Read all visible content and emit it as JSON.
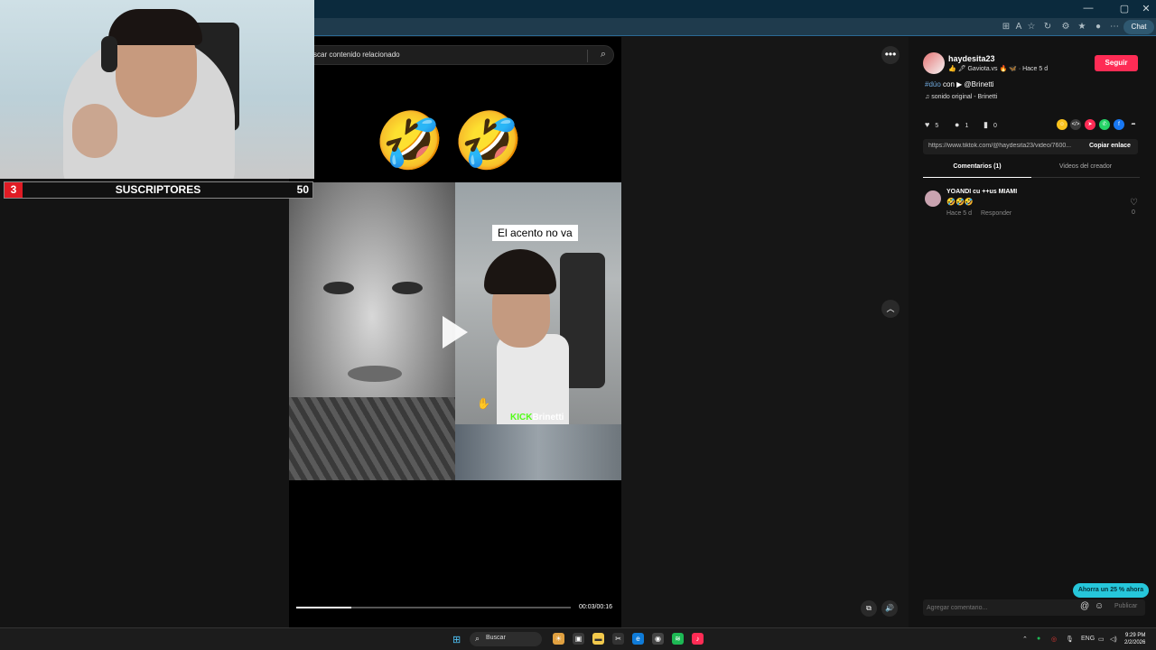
{
  "browser": {
    "chat_label": "Chat",
    "window_buttons": [
      "—",
      "▢",
      "✕"
    ]
  },
  "stream_overlay": {
    "sub_count_left": "3",
    "sub_label": "SUSCRIPTORES",
    "sub_count_right": "50"
  },
  "search": {
    "placeholder": "scar contenido relacionado"
  },
  "video": {
    "emojis": "🤣🤣",
    "caption": "El acento no va",
    "kick_brand": "KICK",
    "kick_user": "Brinetti",
    "time": "00:03/00:16",
    "progress": 0.2
  },
  "post": {
    "username": "haydesita23",
    "display_name": "👍 🖋 Gaviota.vs 🔥 🦋 · Hace 5 d",
    "follow_label": "Seguir",
    "duo_tag": "#dúo",
    "duo_text": "con",
    "duo_user": "▶ @Brinetti",
    "music": "♫  sonido original - Brinetti",
    "likes": "5",
    "comments": "1",
    "saves": "0",
    "link": "https://www.tiktok.com/@haydesita23/video/7600...",
    "copy_link_label": "Copiar enlace",
    "share_colors": [
      "#f9c21d",
      "#3a3a3a",
      "#fe2c55",
      "#25d366",
      "#1877f2"
    ]
  },
  "tabs": {
    "comments": "Comentarios (1)",
    "videos": "Videos del creador"
  },
  "comment": {
    "user": "YOANDI cu ++us MIAMI",
    "text": "🤣🤣🤣",
    "time": "Hace 5 d",
    "reply": "Responder",
    "likes": "0"
  },
  "comment_bar": {
    "placeholder": "Agregar comentario...",
    "publish": "Publicar"
  },
  "promo": "Ahorra un 25 % ahora",
  "taskbar": {
    "search": "Buscar",
    "lang": "ENG",
    "time": "9:29 PM",
    "date": "2/2/2026"
  }
}
